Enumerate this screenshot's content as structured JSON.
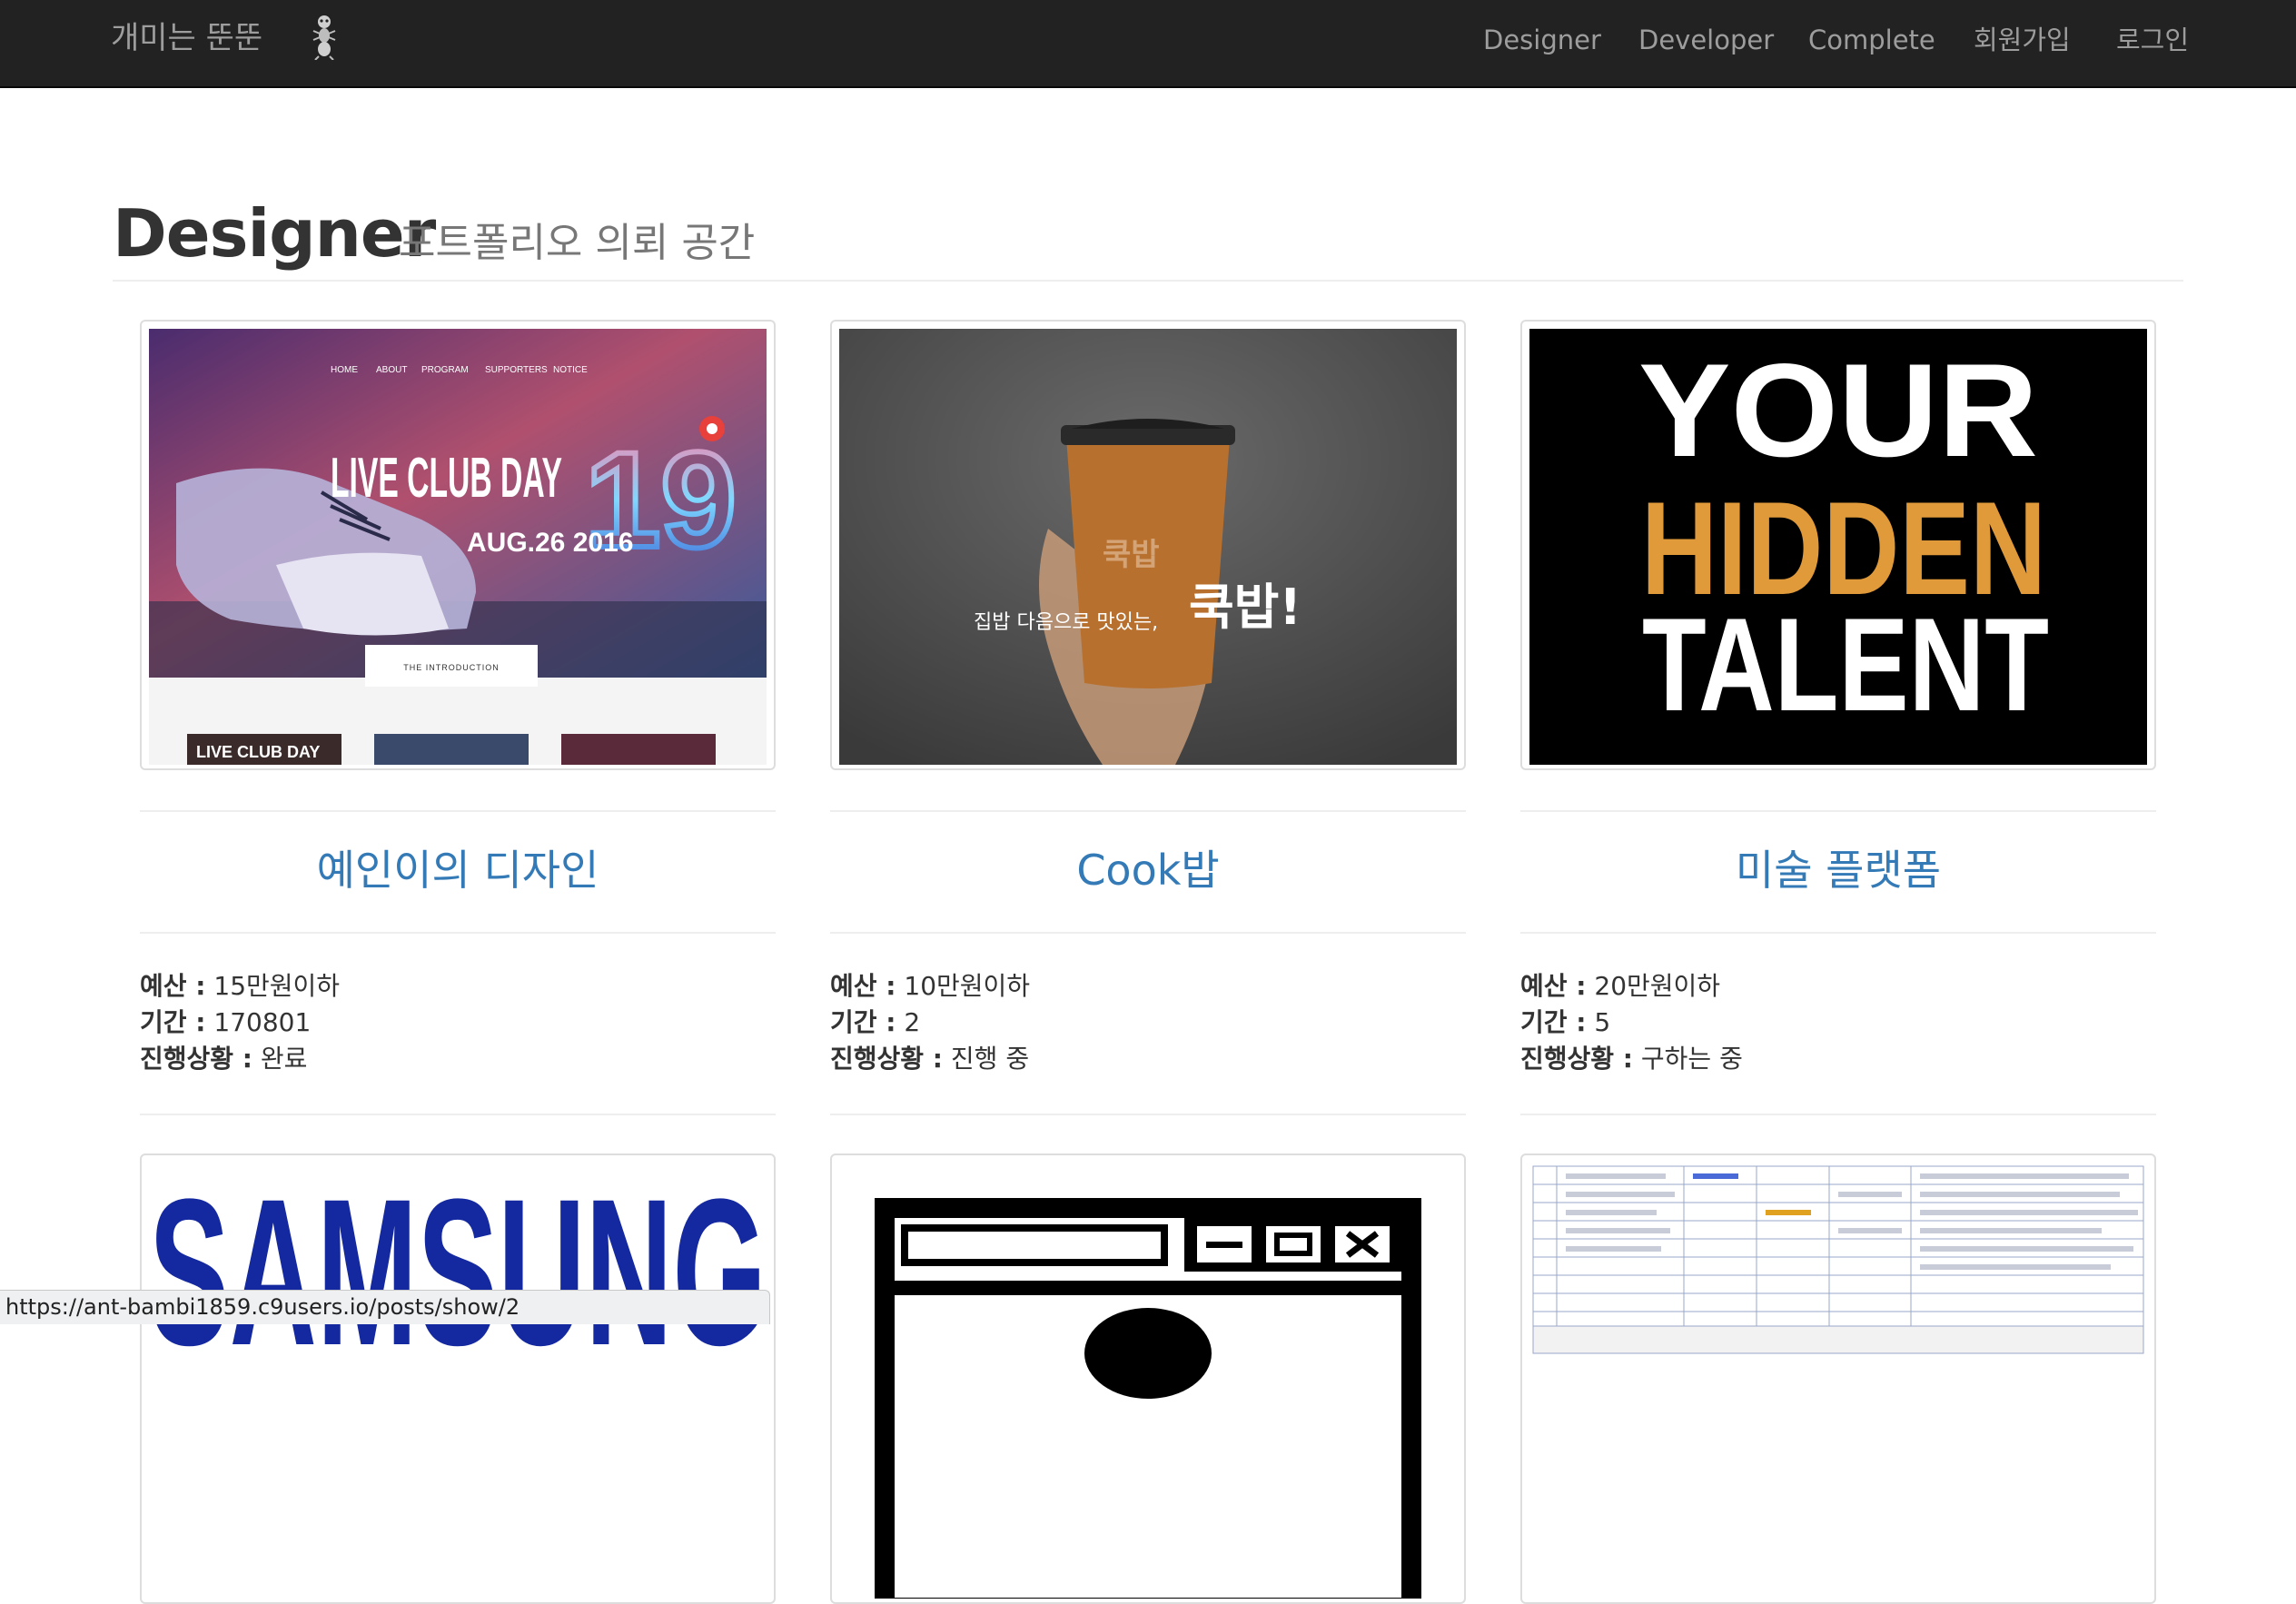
{
  "navbar": {
    "brand": "개미는 뚠뚠",
    "links": [
      "Designer",
      "Developer",
      "Complete",
      "회원가입",
      "로그인"
    ]
  },
  "header": {
    "title": "Designer",
    "subtitle": "포트폴리오 의뢰 공간"
  },
  "cards": [
    {
      "title": "예인이의 디자인",
      "budget_label": "예산 :",
      "budget": "15만원이하",
      "period_label": "기간 :",
      "period": "170801",
      "status_label": "진행상황 :",
      "status": "완료",
      "image_text": {
        "headline": "LIVE CLUB DAY",
        "number": "19",
        "date": "AUG.26 2016",
        "intro": "THE INTRODUCTION",
        "nav": [
          "HOME",
          "ABOUT",
          "PROGRAM",
          "SUPPORTERS",
          "NOTICE"
        ],
        "mini_title": "LIVE CLUB DAY"
      }
    },
    {
      "title": "Cook밥",
      "budget_label": "예산 :",
      "budget": "10만원이하",
      "period_label": "기간 :",
      "period": "2",
      "status_label": "진행상황 :",
      "status": "진행 중",
      "image_text": {
        "tagline": "집밥 다음으로 맛있는,",
        "brand": "쿡밥!",
        "cup_mark": "쿡밥"
      }
    },
    {
      "title": "미술 플랫폼",
      "budget_label": "예산 :",
      "budget": "20만원이하",
      "period_label": "기간 :",
      "period": "5",
      "status_label": "진행상황 :",
      "status": "구하는 중",
      "image_text": {
        "line1": "YOUR",
        "line2": "HIDDEN",
        "line3": "TALENT"
      }
    }
  ],
  "row2_images": {
    "card4_text": "SAMSUNG"
  },
  "status_url": "https://ant-bambi1859.c9users.io/posts/show/2",
  "colors": {
    "navbar_bg": "#222222",
    "link": "#337ab7",
    "talent_gold": "#e09a3a",
    "samsung_blue": "#1428a0"
  }
}
